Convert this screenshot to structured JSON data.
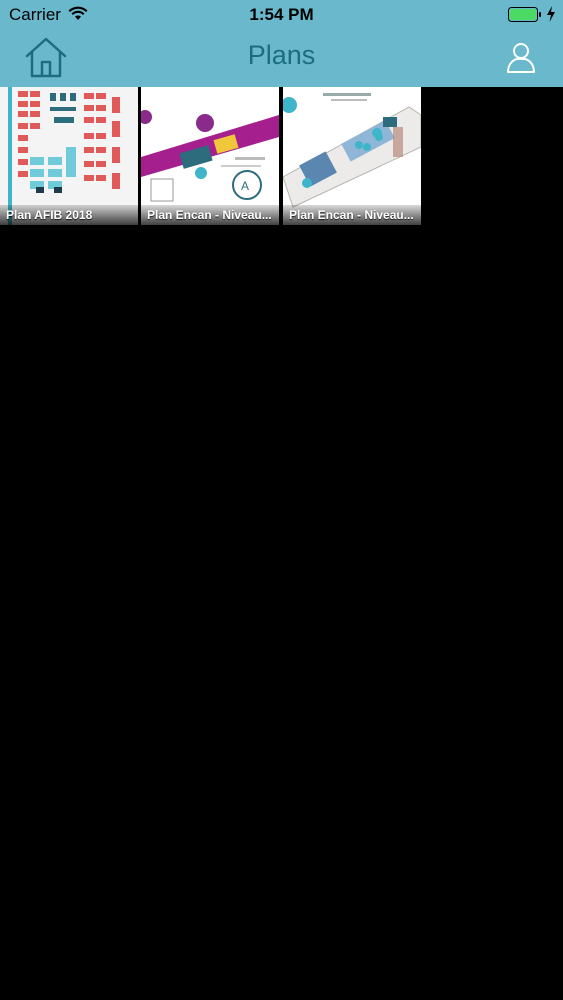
{
  "status_bar": {
    "carrier": "Carrier",
    "time": "1:54 PM",
    "battery_color": "#4cd964"
  },
  "nav_bar": {
    "title": "Plans",
    "left_icon": "home-icon",
    "right_icon": "user-icon",
    "background_color": "#69b8cc",
    "title_color": "#1d6d80"
  },
  "plans": [
    {
      "label": "Plan AFIB 2018"
    },
    {
      "label": "Plan Encan - Niveau..."
    },
    {
      "label": "Plan Encan - Niveau..."
    }
  ]
}
